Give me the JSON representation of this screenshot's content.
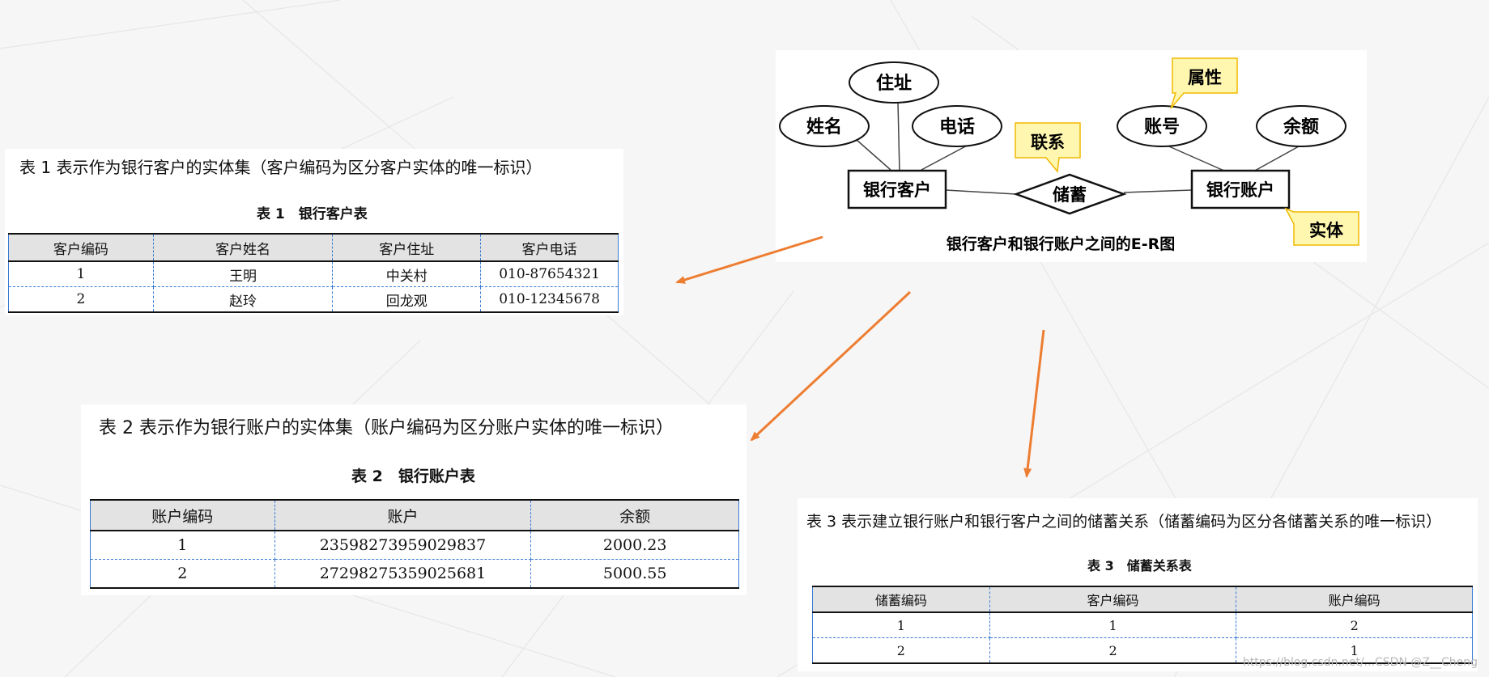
{
  "er": {
    "attr_address": "住址",
    "attr_name": "姓名",
    "attr_phone": "电话",
    "attr_account_no": "账号",
    "attr_balance": "余额",
    "entity_customer": "银行客户",
    "entity_account": "银行账户",
    "relationship": "储蓄",
    "callout_relationship": "联系",
    "callout_attribute": "属性",
    "callout_entity": "实体",
    "caption": "银行客户和银行账户之间的E-R图",
    "callout_color": "#fff7b0",
    "callout_border": "#f0b800"
  },
  "table1": {
    "desc": "表 1 表示作为银行客户的实体集（客户编码为区分客户实体的唯一标识）",
    "caption": "表 1　银行客户表",
    "headers": [
      "客户编码",
      "客户姓名",
      "客户住址",
      "客户电话"
    ],
    "rows": [
      [
        "1",
        "王明",
        "中关村",
        "010-87654321"
      ],
      [
        "2",
        "赵玲",
        "回龙观",
        "010-12345678"
      ]
    ]
  },
  "table2": {
    "desc": "表 2 表示作为银行账户的实体集（账户编码为区分账户实体的唯一标识）",
    "caption": "表 2　银行账户表",
    "headers": [
      "账户编码",
      "账户",
      "余额"
    ],
    "rows": [
      [
        "1",
        "23598273959029837",
        "2000.23"
      ],
      [
        "2",
        "27298275359025681",
        "5000.55"
      ]
    ]
  },
  "table3": {
    "desc": "表 3 表示建立银行账户和银行客户之间的储蓄关系（储蓄编码为区分各储蓄关系的唯一标识）",
    "caption": "表 3　储蓄关系表",
    "headers": [
      "储蓄编码",
      "客户编码",
      "账户编码"
    ],
    "rows": [
      [
        "1",
        "1",
        "2"
      ],
      [
        "2",
        "2",
        "1"
      ]
    ]
  },
  "arrow_color": "#ed7d31",
  "watermark": "https://blog.csdn.net/...CSDN @Z__Cheng"
}
